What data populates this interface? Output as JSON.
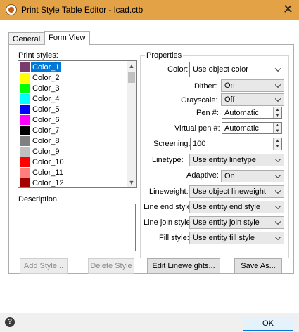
{
  "window": {
    "title": "Print Style Table Editor - lcad.ctb",
    "close_glyph": "✕"
  },
  "tabs": [
    {
      "label": "General"
    },
    {
      "label": "Form View"
    }
  ],
  "print_styles": {
    "label": "Print styles:",
    "items": [
      {
        "name": "Color_1",
        "color": "#7b3b6e",
        "selected": true
      },
      {
        "name": "Color_2",
        "color": "#ffff00"
      },
      {
        "name": "Color_3",
        "color": "#00ff00"
      },
      {
        "name": "Color_4",
        "color": "#00ffff"
      },
      {
        "name": "Color_5",
        "color": "#0000ff"
      },
      {
        "name": "Color_6",
        "color": "#ff00ff"
      },
      {
        "name": "Color_7",
        "color": "#000000"
      },
      {
        "name": "Color_8",
        "color": "#808080"
      },
      {
        "name": "Color_9",
        "color": "#c0c0c0"
      },
      {
        "name": "Color_10",
        "color": "#ff0000"
      },
      {
        "name": "Color_11",
        "color": "#ff7f7f"
      },
      {
        "name": "Color_12",
        "color": "#a50000"
      }
    ]
  },
  "description": {
    "label": "Description:",
    "value": ""
  },
  "properties": {
    "title": "Properties",
    "color": {
      "label": "Color:",
      "value": "Use object color"
    },
    "dither": {
      "label": "Dither:",
      "value": "On"
    },
    "grayscale": {
      "label": "Grayscale:",
      "value": "Off"
    },
    "pen": {
      "label": "Pen #:",
      "value": "Automatic"
    },
    "virtual_pen": {
      "label": "Virtual pen #:",
      "value": "Automatic"
    },
    "screening": {
      "label": "Screening:",
      "value": "100"
    },
    "linetype": {
      "label": "Linetype:",
      "value": "Use entity linetype"
    },
    "adaptive": {
      "label": "Adaptive:",
      "value": "On"
    },
    "lineweight": {
      "label": "Lineweight:",
      "value": "Use object lineweight"
    },
    "line_end_style": {
      "label": "Line end style:",
      "value": "Use entity end style"
    },
    "line_join_style": {
      "label": "Line join style:",
      "value": "Use entity join style"
    },
    "fill_style": {
      "label": "Fill style:",
      "value": "Use entity fill style"
    }
  },
  "buttons": {
    "add_style": "Add Style...",
    "delete_style": "Delete Style",
    "edit_lineweights": "Edit Lineweights...",
    "save_as": "Save As...",
    "ok": "OK"
  },
  "footer": {
    "help_glyph": "?"
  }
}
